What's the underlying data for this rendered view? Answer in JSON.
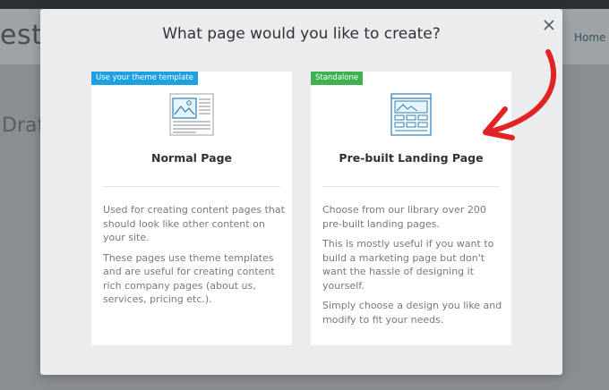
{
  "background": {
    "site_title": "esti",
    "nav_link": "Home",
    "draft_text": "Draf"
  },
  "modal": {
    "title": "What page would you like to create?",
    "close_icon": "close-icon",
    "cards": [
      {
        "badge": "Use your theme template",
        "badge_color": "#1da1e2",
        "icon": "page-template-icon",
        "title": "Normal Page",
        "paragraphs": [
          "Used for creating content pages that should look like other content on your site.",
          "These pages use theme templates and are useful for creating content rich company pages (about us, services, pricing etc.)."
        ]
      },
      {
        "badge": "Standalone",
        "badge_color": "#3fb24f",
        "icon": "landing-page-icon",
        "title": "Pre-built Landing Page",
        "paragraphs": [
          "Choose from our library over 200 pre-built landing pages.",
          "This is mostly useful if you want to build a marketing page but don't want the hassle of designing it yourself.",
          "Simply choose a design you like and modify to fit your needs."
        ]
      }
    ]
  },
  "annotation": {
    "arrow_color": "#e02424"
  }
}
